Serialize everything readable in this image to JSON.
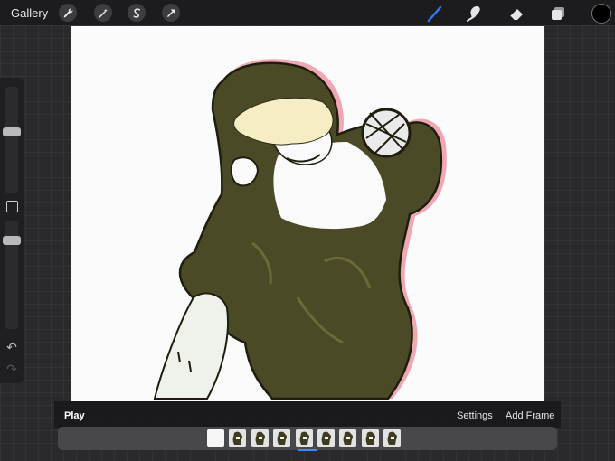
{
  "topbar": {
    "gallery_label": "Gallery",
    "left_tools": [
      "wrench-icon",
      "magic-wand-icon",
      "selection-icon",
      "transform-arrow-icon"
    ],
    "right_tools": [
      "brush-icon",
      "smudge-icon",
      "eraser-icon",
      "layers-icon"
    ],
    "active_tool": "brush-icon",
    "accent_color": "#2f7cf6",
    "current_color": "#000000"
  },
  "sidebar": {
    "brush_size_level": 0.58,
    "opacity_level": 0.1,
    "undo_icon": "undo-icon",
    "redo_icon": "redo-icon"
  },
  "animation": {
    "play_label": "Play",
    "settings_label": "Settings",
    "add_frame_label": "Add Frame",
    "frame_count": 9,
    "selected_frame": 5
  },
  "canvas": {
    "background": "#fbfbfb",
    "figure_color": "#4b4a26"
  }
}
